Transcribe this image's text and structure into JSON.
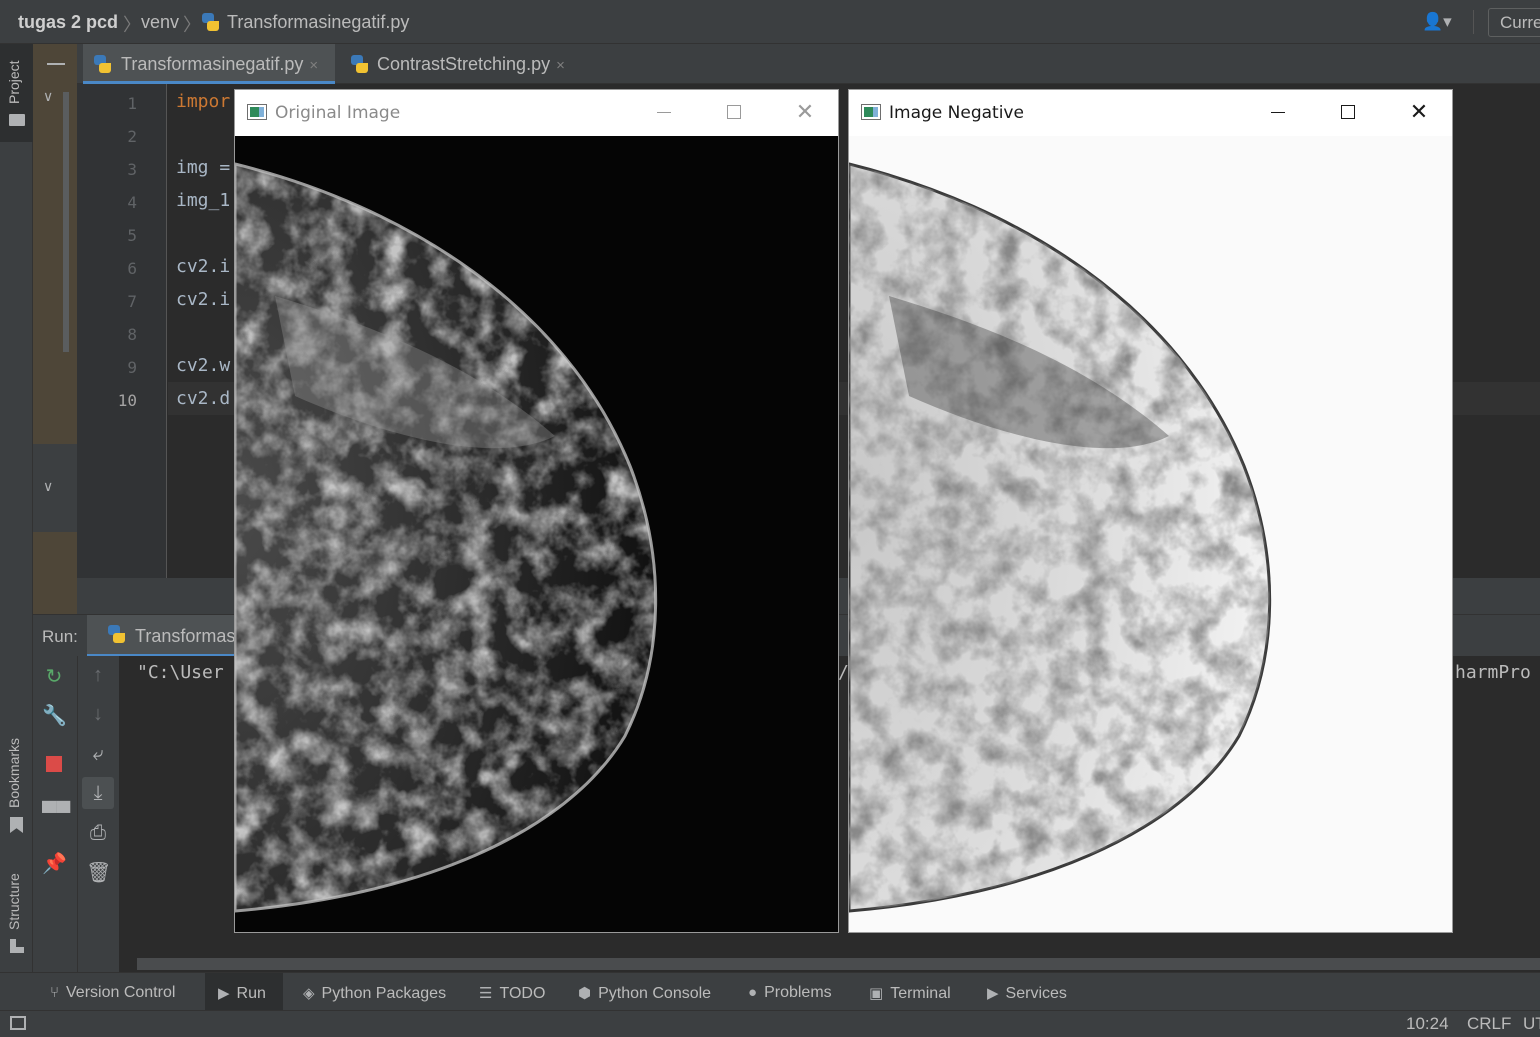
{
  "titlebar": {
    "project": "tugas 2 pcd",
    "folder": "venv",
    "file": "Transformasinegatif.py",
    "current_button": "Curre"
  },
  "left_strip": {
    "project_tab": "Project",
    "bookmarks_tab": "Bookmarks",
    "structure_tab": "Structure"
  },
  "editor_tabs": [
    {
      "label": "Transformasinegatif.py",
      "close": "×"
    },
    {
      "label": "ContrastStretching.py",
      "close": "×"
    }
  ],
  "editor": {
    "line_numbers": [
      "1",
      "2",
      "3",
      "4",
      "5",
      "6",
      "7",
      "8",
      "9",
      "10"
    ],
    "code_lines": [
      "impor",
      "",
      "img =",
      "img_1",
      "",
      "cv2.i",
      "cv2.i",
      "",
      "cv2.w",
      "cv2.d"
    ]
  },
  "run_panel": {
    "label": "Run:",
    "tab": "Transformas",
    "output_left": "\"C:\\User",
    "output_mid": "/",
    "output_right": "harmPro"
  },
  "bottom_tabs": [
    {
      "label": "Version Control",
      "icon": "branch-icon"
    },
    {
      "label": "Run",
      "icon": "run-icon"
    },
    {
      "label": "Python Packages",
      "icon": "layers-icon"
    },
    {
      "label": "TODO",
      "icon": "list-icon"
    },
    {
      "label": "Python Console",
      "icon": "python-icon"
    },
    {
      "label": "Problems",
      "icon": "info-icon"
    },
    {
      "label": "Terminal",
      "icon": "terminal-icon"
    },
    {
      "label": "Services",
      "icon": "services-icon"
    }
  ],
  "status": {
    "time": "10:24",
    "line_sep": "CRLF",
    "encoding": "UT"
  },
  "windows": [
    {
      "title": "Original Image",
      "background": "#050505",
      "tissue": "light"
    },
    {
      "title": "Image Negative",
      "background": "#fafafa",
      "tissue": "dark"
    }
  ],
  "colors": {
    "ide_bg": "#2b2b2b",
    "panel": "#3c3f41",
    "keyword": "#cc7832",
    "accent": "#4a88c7",
    "stop": "#db4b48"
  }
}
